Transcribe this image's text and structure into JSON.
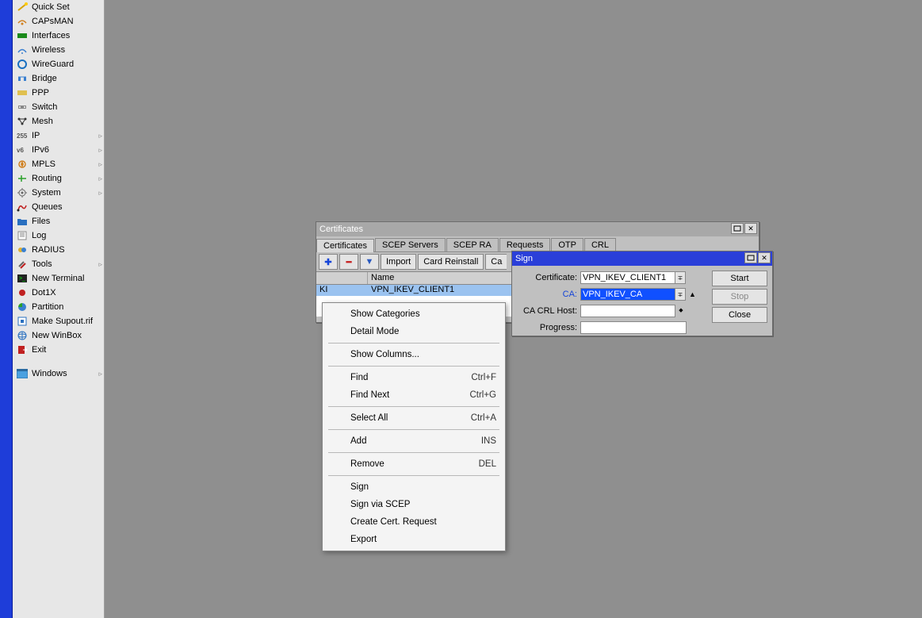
{
  "sidebar": {
    "items": [
      {
        "label": "Quick Set",
        "icon": "wand"
      },
      {
        "label": "CAPsMAN",
        "icon": "wifi-cap"
      },
      {
        "label": "Interfaces",
        "icon": "interfaces"
      },
      {
        "label": "Wireless",
        "icon": "wireless"
      },
      {
        "label": "WireGuard",
        "icon": "wireguard"
      },
      {
        "label": "Bridge",
        "icon": "bridge"
      },
      {
        "label": "PPP",
        "icon": "ppp"
      },
      {
        "label": "Switch",
        "icon": "switch"
      },
      {
        "label": "Mesh",
        "icon": "mesh"
      },
      {
        "label": "IP",
        "icon": "ip",
        "submenu": true
      },
      {
        "label": "IPv6",
        "icon": "ipv6",
        "submenu": true
      },
      {
        "label": "MPLS",
        "icon": "mpls",
        "submenu": true
      },
      {
        "label": "Routing",
        "icon": "routing",
        "submenu": true
      },
      {
        "label": "System",
        "icon": "system",
        "submenu": true
      },
      {
        "label": "Queues",
        "icon": "queues"
      },
      {
        "label": "Files",
        "icon": "files"
      },
      {
        "label": "Log",
        "icon": "log"
      },
      {
        "label": "RADIUS",
        "icon": "radius"
      },
      {
        "label": "Tools",
        "icon": "tools",
        "submenu": true
      },
      {
        "label": "New Terminal",
        "icon": "terminal"
      },
      {
        "label": "Dot1X",
        "icon": "dot1x"
      },
      {
        "label": "Partition",
        "icon": "partition"
      },
      {
        "label": "Make Supout.rif",
        "icon": "supout"
      },
      {
        "label": "New WinBox",
        "icon": "winbox"
      },
      {
        "label": "Exit",
        "icon": "exit"
      }
    ],
    "windows_label": "Windows"
  },
  "cert_window": {
    "title": "Certificates",
    "tabs": [
      "Certificates",
      "SCEP Servers",
      "SCEP RA",
      "Requests",
      "OTP",
      "CRL"
    ],
    "active_tab": 0,
    "toolbar": {
      "import": "Import",
      "card_reinstall": "Card Reinstall",
      "card_verify_prefix": "Ca"
    },
    "columns": {
      "flags": "",
      "name": "Name"
    },
    "rows": [
      {
        "flags": "KI",
        "name": "VPN_IKEV_CLIENT1"
      }
    ]
  },
  "sign_window": {
    "title": "Sign",
    "labels": {
      "certificate": "Certificate:",
      "ca": "CA:",
      "ca_crl_host": "CA CRL Host:",
      "progress": "Progress:"
    },
    "values": {
      "certificate": "VPN_IKEV_CLIENT1",
      "ca": "VPN_IKEV_CA",
      "ca_crl_host": "",
      "progress": ""
    },
    "buttons": {
      "start": "Start",
      "stop": "Stop",
      "close": "Close"
    }
  },
  "context_menu": {
    "items": [
      {
        "label": "Show Categories"
      },
      {
        "label": "Detail Mode"
      },
      {
        "sep": true
      },
      {
        "label": "Show Columns..."
      },
      {
        "sep": true
      },
      {
        "label": "Find",
        "shortcut": "Ctrl+F"
      },
      {
        "label": "Find Next",
        "shortcut": "Ctrl+G"
      },
      {
        "sep": true
      },
      {
        "label": "Select All",
        "shortcut": "Ctrl+A"
      },
      {
        "sep": true
      },
      {
        "label": "Add",
        "shortcut": "INS"
      },
      {
        "sep": true
      },
      {
        "label": "Remove",
        "shortcut": "DEL"
      },
      {
        "sep": true
      },
      {
        "label": "Sign"
      },
      {
        "label": "Sign via SCEP"
      },
      {
        "label": "Create Cert. Request"
      },
      {
        "label": "Export"
      }
    ]
  }
}
